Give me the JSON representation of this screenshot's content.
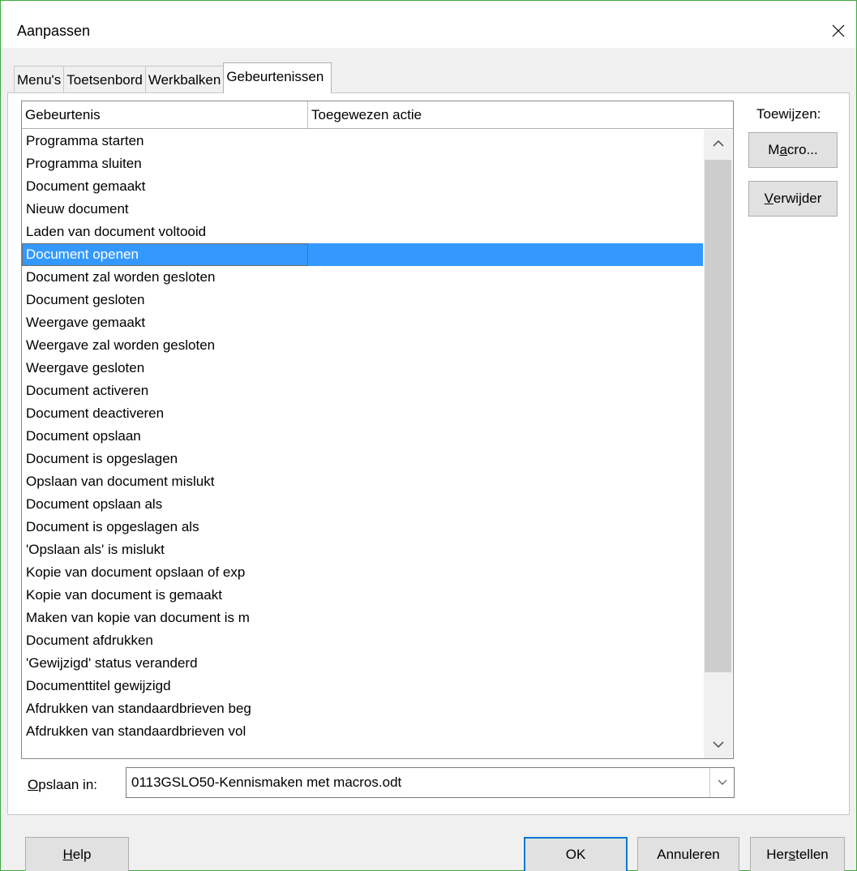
{
  "window": {
    "title": "Aanpassen"
  },
  "tabs": [
    {
      "label": "Menu's"
    },
    {
      "label": "Toetsenbord"
    },
    {
      "label": "Werkbalken"
    },
    {
      "label": "Gebeurtenissen"
    }
  ],
  "active_tab": "Gebeurtenissen",
  "list": {
    "headers": {
      "event": "Gebeurtenis",
      "action": "Toegewezen actie"
    },
    "rows": [
      "Programma starten",
      "Programma sluiten",
      "Document gemaakt",
      "Nieuw document",
      "Laden van document voltooid",
      "Document openen",
      "Document zal worden gesloten",
      "Document gesloten",
      "Weergave gemaakt",
      "Weergave zal worden gesloten",
      "Weergave gesloten",
      "Document activeren",
      "Document deactiveren",
      "Document opslaan",
      "Document is opgeslagen",
      "Opslaan van document mislukt",
      "Document opslaan als",
      "Document is opgeslagen als",
      "'Opslaan als' is mislukt",
      "Kopie van document opslaan of exp",
      "Kopie van document is gemaakt",
      "Maken van kopie van document is m",
      "Document afdrukken",
      "'Gewijzigd' status veranderd",
      "Documenttitel gewijzigd",
      "Afdrukken van standaardbrieven beg",
      "Afdrukken van standaardbrieven vol"
    ],
    "selected_row": "Document openen"
  },
  "assign": {
    "label": "Toewijzen:",
    "macro_pre": "M",
    "macro_key": "a",
    "macro_post": "cro...",
    "delete_key": "V",
    "delete_post": "erwijder"
  },
  "save_in": {
    "label_key": "O",
    "label_post": "pslaan in:",
    "value": "0113GSLO50-Kennismaken met macros.odt"
  },
  "footer": {
    "help_key": "H",
    "help_post": "elp",
    "ok": "OK",
    "cancel": "Annuleren",
    "reset_pre": "Her",
    "reset_key": "s",
    "reset_post": "tellen"
  }
}
